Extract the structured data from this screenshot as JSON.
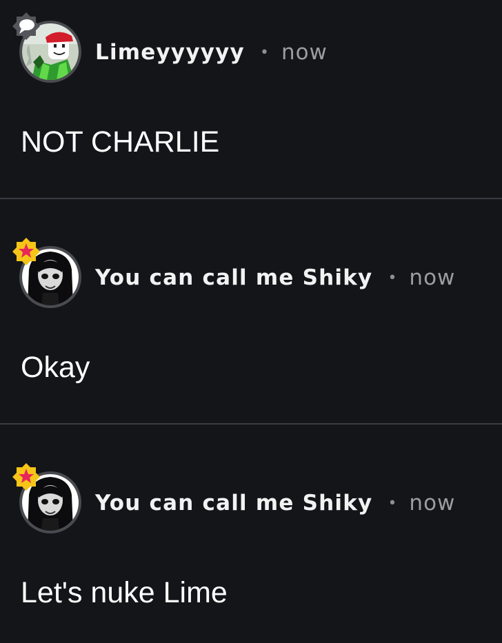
{
  "messages": [
    {
      "author": "Limeyyyyyy",
      "separator": "•",
      "time": "now",
      "text": "NOT CHARLIE",
      "avatar": "red-cap-green-shirt-avatar",
      "badge": "speech-bubble-badge"
    },
    {
      "author": "You can call me Shiky",
      "separator": "•",
      "time": "now",
      "text": "Okay",
      "avatar": "pale-face-dark-hair-avatar",
      "badge": "star-badge"
    },
    {
      "author": "You can call me Shiky",
      "separator": "•",
      "time": "now",
      "text": "Let's nuke Lime",
      "avatar": "pale-face-dark-hair-avatar",
      "badge": "star-badge"
    }
  ],
  "colors": {
    "background": "#141519",
    "divider": "#3a3c43",
    "star_badge": "#f5c518",
    "star": "#e8265a",
    "speech_badge": "#55565b"
  }
}
